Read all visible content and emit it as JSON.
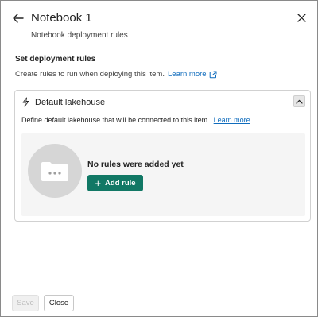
{
  "header": {
    "title": "Notebook 1",
    "subtitle": "Notebook deployment rules"
  },
  "section": {
    "title": "Set deployment rules",
    "description": "Create rules to run when deploying this item.",
    "learn_more": "Learn more"
  },
  "card": {
    "title": "Default lakehouse",
    "description": "Define default lakehouse that will be connected to this item.",
    "learn_more": "Learn more",
    "empty_state": {
      "title": "No rules were added yet",
      "add_rule_label": "Add rule"
    }
  },
  "footer": {
    "save_label": "Save",
    "close_label": "Close"
  },
  "colors": {
    "accent": "#117865",
    "link": "#0f6cbd"
  }
}
